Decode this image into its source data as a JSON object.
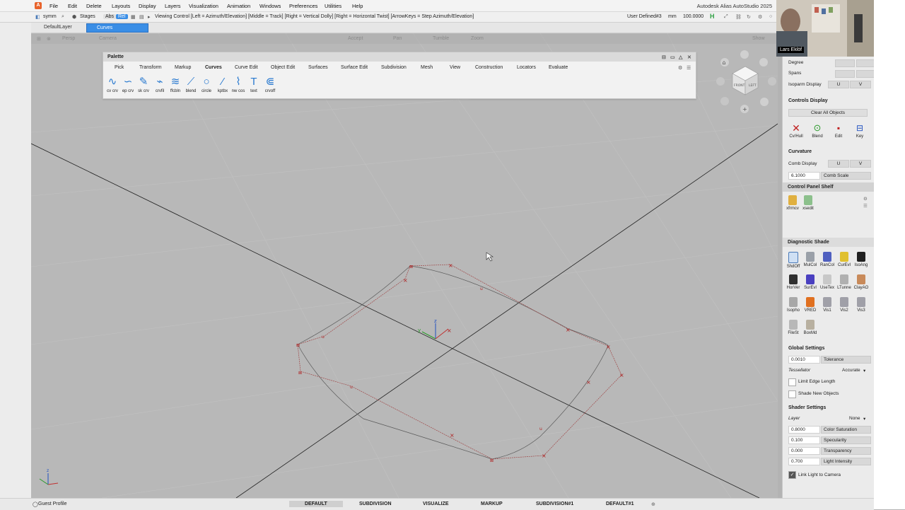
{
  "app": {
    "title": "Autodesk Alias AutoStudio 2025",
    "menus": [
      "File",
      "Edit",
      "Delete",
      "Layouts",
      "Display",
      "Layers",
      "Visualization",
      "Animation",
      "Windows",
      "Preferences",
      "Utilities",
      "Help"
    ]
  },
  "toolbar": {
    "symm": "symm",
    "stages": "Stages",
    "abs": "Abs",
    "rel": "Rel",
    "viewing_hint": "Viewing Control  [Left = Azimuth/Elevation]  [Middle = Track]  [Right = Vertical Dolly]  [Right = Horizontal Twist]  [ArrowKeys = Step Azimuth/Elevation]",
    "construction": "User Defined#3",
    "units": "mm",
    "scale": "100.0000",
    "h_indicator": "H"
  },
  "layers": {
    "default": "DefaultLayer",
    "active": "Curves"
  },
  "viewport": {
    "persp": "Persp",
    "camera": "Camera",
    "accept": "Accept",
    "pan": "Pan",
    "tumble": "Tumble",
    "zoom": "Zoom",
    "show": "Show"
  },
  "viewcube": {
    "front": "FRONT",
    "left": "LEFT"
  },
  "palette": {
    "title": "Palette",
    "tabs": [
      "Pick",
      "Transform",
      "Markup",
      "Curves",
      "Curve Edit",
      "Object Edit",
      "Surfaces",
      "Surface Edit",
      "Subdivision",
      "Mesh",
      "View",
      "Construction",
      "Locators",
      "Evaluate"
    ],
    "active_tab": "Curves",
    "tools": [
      {
        "label": "cv crv",
        "glyph": "∿"
      },
      {
        "label": "ep crv",
        "glyph": "∽"
      },
      {
        "label": "sk crv",
        "glyph": "✎"
      },
      {
        "label": "crvfil",
        "glyph": "⌁"
      },
      {
        "label": "ffcbln",
        "glyph": "≋"
      },
      {
        "label": "blend",
        "glyph": "⟋"
      },
      {
        "label": "circle",
        "glyph": "○"
      },
      {
        "label": "kptbx",
        "glyph": "⁄"
      },
      {
        "label": "nw cos",
        "glyph": "⌇"
      },
      {
        "label": "text",
        "glyph": "T"
      },
      {
        "label": "crvoff",
        "glyph": "⋐"
      }
    ]
  },
  "right_panel": {
    "degree": "Degree",
    "spans": "Spans",
    "isoparm": "Isoparm Display",
    "u": "U",
    "v": "V",
    "controls_display": "Controls Display",
    "clear_all": "Clear All Objects",
    "controls": [
      "Cv/Hull",
      "Blend",
      "Edit",
      "Key"
    ],
    "curvature": "Curvature",
    "comb_display": "Comb Display",
    "comb_value": "6.1000",
    "comb_scale": "Comb Scale",
    "shelf_title": "Control Panel Shelf",
    "shelf_items": [
      "xfrmcv",
      "xsedit"
    ],
    "diag_title": "Diagnostic Shade",
    "diag_items": [
      "ShdOff",
      "MulCol",
      "RanCol",
      "CurEvl",
      "IsoAng",
      "HorVer",
      "SurEvl",
      "UseTex",
      "LTunne",
      "ClayAO",
      "Isopho",
      "VRED",
      "Vis1",
      "Vis2",
      "Vis3",
      "FileSt",
      "BoxMd"
    ],
    "global_settings": "Global Settings",
    "tolerance_value": "0.0010",
    "tolerance": "Tolerance",
    "tessellator": "Tessellator",
    "tessellator_value": "Accurate",
    "limit_edge": "Limit Edge Length",
    "shade_new": "Shade New Objects",
    "shader_settings": "Shader Settings",
    "layer": "Layer",
    "layer_value": "None",
    "color_sat_value": "0.8000",
    "color_sat": "Color Saturation",
    "specularity_value": "0.100",
    "specularity": "Specularity",
    "transparency_value": "0.000",
    "transparency": "Transparency",
    "light_value": "0.700",
    "light": "Light Intensity",
    "link_light": "Link Light to Camera"
  },
  "bottom": {
    "guest": "Guest Profile",
    "tabs": [
      "DEFAULT",
      "SUBDIVISION",
      "VISUALIZE",
      "MARKUP",
      "SUBDIVISION#1",
      "DEFAULT#1"
    ],
    "active": "DEFAULT"
  },
  "webcam": {
    "name": "Lars Eklöf"
  },
  "axes": {
    "y": "y",
    "z": "z",
    "x": "x"
  }
}
